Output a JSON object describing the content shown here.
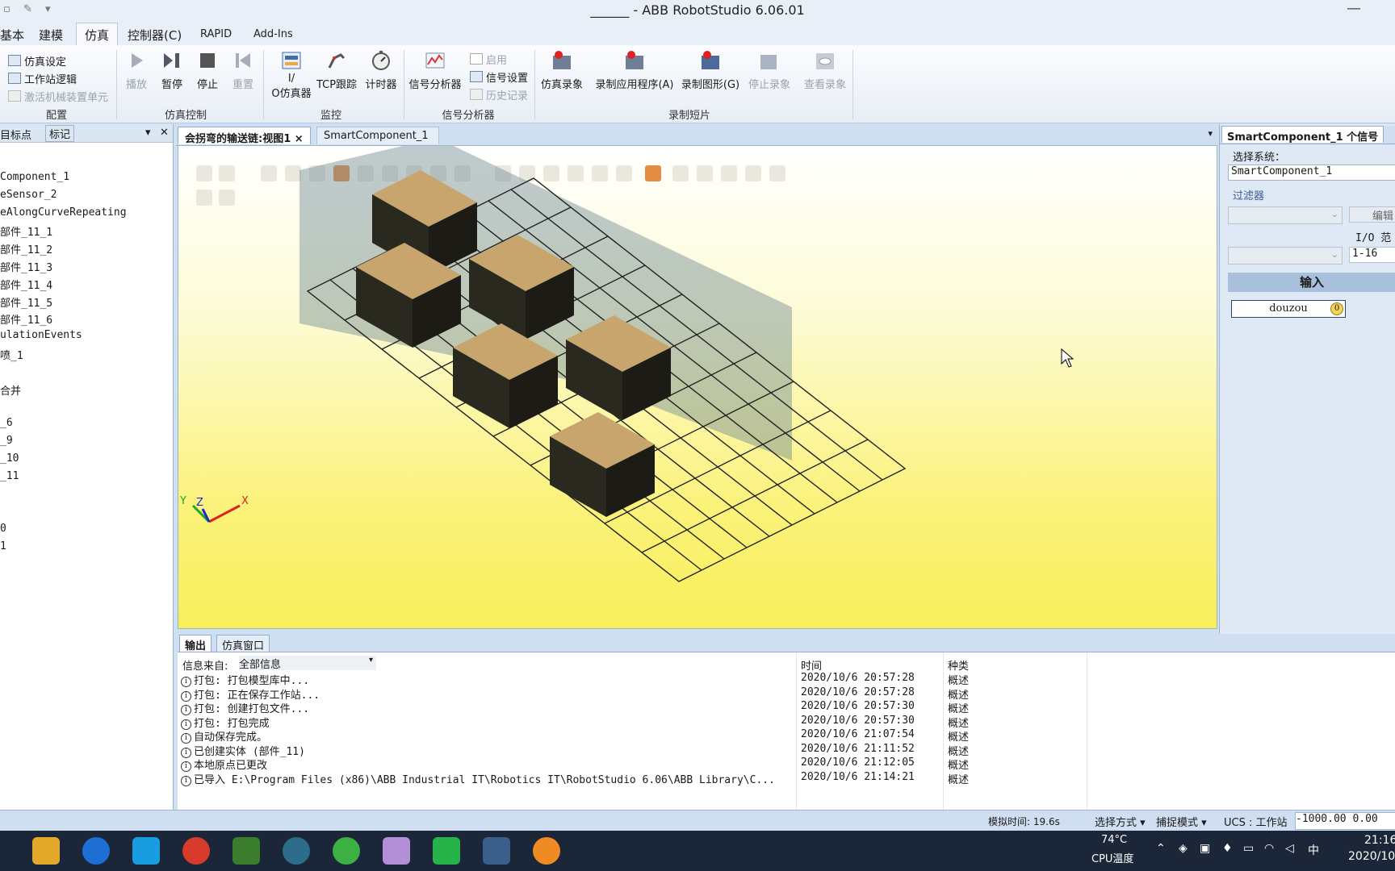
{
  "window": {
    "title": "______ - ABB RobotStudio 6.06.01"
  },
  "ribbon": {
    "tabs": [
      "基本",
      "建模",
      "仿真",
      "控制器(C)",
      "RAPID",
      "Add-Ins"
    ],
    "active_tab": "仿真",
    "config": {
      "items": [
        "仿真设定",
        "工作站逻辑",
        "激活机械装置单元"
      ],
      "label": "配置"
    },
    "sim_control": {
      "buttons": [
        "播放",
        "暂停",
        "停止",
        "重置"
      ],
      "label": "仿真控制"
    },
    "monitor": {
      "buttons": [
        "I/O仿真器",
        "TCP跟踪",
        "计时器"
      ],
      "io_line1": "I/",
      "io_line2": "O仿真器",
      "label": "监控"
    },
    "signal": {
      "analyzer": "信号分析器",
      "enable": "启用",
      "settings": "信号设置",
      "history": "历史记录",
      "label": "信号分析器"
    },
    "record": {
      "buttons": [
        "仿真录象",
        "录制应用程序(A)",
        "录制图形(G)",
        "停止录象",
        "查看录象"
      ],
      "label": "录制短片"
    }
  },
  "left_panel": {
    "tabs": [
      "目标点",
      "标记"
    ],
    "items": [
      "Component_1",
      "eSensor_2",
      "eAlongCurveRepeating",
      "部件_11_1",
      "部件_11_2",
      "部件_11_3",
      "部件_11_4",
      "部件_11_5",
      "部件_11_6",
      "ulationEvents",
      "喷_1",
      "",
      "合并",
      "",
      "_6",
      "_9",
      "_10",
      "_11",
      "",
      "",
      "0",
      "1"
    ]
  },
  "doc_tabs": [
    "会拐弯的输送链:视图1",
    "SmartComponent_1"
  ],
  "right_panel": {
    "tab": "SmartComponent_1 个信号",
    "select_system_label": "选择系统：",
    "system_value": "SmartComponent_1",
    "filter_label": "过滤器",
    "edit_button": "编辑",
    "io_range_label": "I/O 范",
    "range_value": "1-16",
    "input_header": "输入",
    "signal_name": "douzou",
    "signal_state": "0"
  },
  "output": {
    "tabs": [
      "输出",
      "仿真窗口"
    ],
    "source_label": "信息来自:",
    "source_value": "全部信息",
    "columns": [
      "时间",
      "种类"
    ],
    "rows": [
      {
        "msg": "打包: 打包模型库中...",
        "time": "2020/10/6 20:57:28",
        "kind": "概述"
      },
      {
        "msg": "打包: 正在保存工作站...",
        "time": "2020/10/6 20:57:28",
        "kind": "概述"
      },
      {
        "msg": "打包: 创建打包文件...",
        "time": "2020/10/6 20:57:30",
        "kind": "概述"
      },
      {
        "msg": "打包: 打包完成",
        "time": "2020/10/6 20:57:30",
        "kind": "概述"
      },
      {
        "msg": "自动保存完成。",
        "time": "2020/10/6 21:07:54",
        "kind": "概述"
      },
      {
        "msg": "已创建实体 (部件_11)",
        "time": "2020/10/6 21:11:52",
        "kind": "概述"
      },
      {
        "msg": "本地原点已更改",
        "time": "2020/10/6 21:12:05",
        "kind": "概述"
      },
      {
        "msg": "已导入 E:\\Program Files (x86)\\ABB Industrial IT\\Robotics IT\\RobotStudio 6.06\\ABB Library\\C...",
        "time": "2020/10/6 21:14:21",
        "kind": "概述"
      }
    ]
  },
  "status": {
    "sim_time": "模拟时间: 19.6s",
    "select_mode": "选择方式",
    "snap_mode": "捕捉模式",
    "ucs": "UCS : 工作站",
    "coords": "-1000.00  0.00"
  },
  "taskbar": {
    "temp": "74°C",
    "temp_label": "CPU温度",
    "ime": "中",
    "time": "21:16",
    "date": "2020/10"
  },
  "axis_labels": {
    "x": "X",
    "y": "Y",
    "z": "Z"
  },
  "colors": {
    "viewport_top": "#ffffff",
    "viewport_bottom": "#f8ef5b",
    "taskbar": "#1b2738"
  }
}
